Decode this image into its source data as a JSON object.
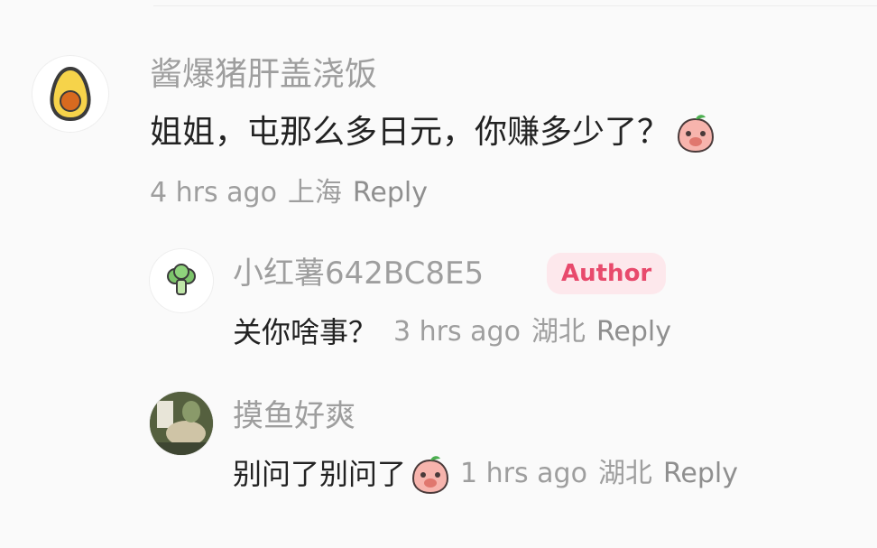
{
  "comments": [
    {
      "username": "酱爆猪肝盖浇饭",
      "text": "姐姐，屯那么多日元，你赚多少了？",
      "emoji_icon": "blushing-peach-icon",
      "time": "4 hrs ago",
      "location": "上海",
      "reply_label": "Reply",
      "avatar_icon": "avocado-icon"
    }
  ],
  "replies": [
    {
      "username": "小红薯642BC8E5",
      "badge": "Author",
      "text": "关你啥事？",
      "time": "3 hrs ago",
      "location": "湖北",
      "reply_label": "Reply",
      "avatar_icon": "broccoli-icon"
    },
    {
      "username": "摸鱼好爽",
      "text": "别问了别问了",
      "emoji_icon": "blushing-peach-icon",
      "time": "1 hrs ago",
      "location": "湖北",
      "reply_label": "Reply",
      "avatar_icon": "photo-avatar"
    }
  ],
  "colors": {
    "username": "#9e9e9e",
    "text": "#222222",
    "badge_bg": "#fde8ec",
    "badge_text": "#e84a6c",
    "background": "#fafafa"
  }
}
